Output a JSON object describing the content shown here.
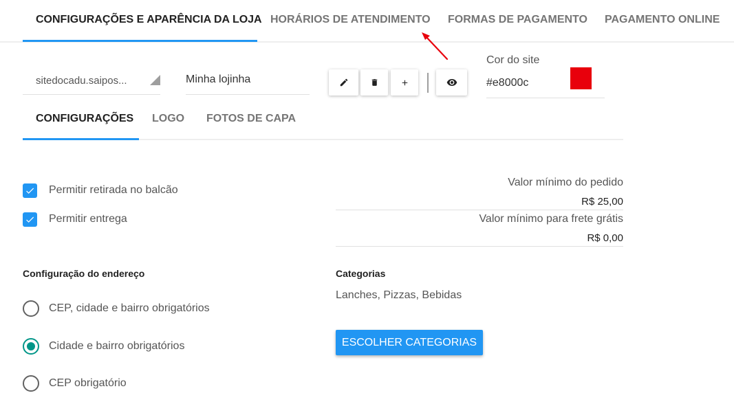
{
  "top_tabs": [
    {
      "label": "CONFIGURAÇÕES E APARÊNCIA DA LOJA",
      "active": true
    },
    {
      "label": "HORÁRIOS DE ATENDIMENTO",
      "active": false
    },
    {
      "label": "FORMAS DE PAGAMENTO",
      "active": false
    },
    {
      "label": "PAGAMENTO ONLINE",
      "active": false
    }
  ],
  "store": {
    "selected_site": "sitedocadu.saipos...",
    "name": "Minha lojinha",
    "buttons": {
      "edit_icon": "pencil-icon",
      "delete_icon": "trash-icon",
      "add_icon": "plus-icon",
      "preview_icon": "eye-icon"
    }
  },
  "site_color": {
    "label": "Cor do site",
    "value": "#e8000c",
    "swatch": "#e8000c"
  },
  "sub_tabs": [
    {
      "label": "CONFIGURAÇÕES",
      "active": true
    },
    {
      "label": "LOGO",
      "active": false
    },
    {
      "label": "FOTOS DE CAPA",
      "active": false
    }
  ],
  "options": [
    {
      "label": "Permitir retirada no balcão",
      "checked": true
    },
    {
      "label": "Permitir entrega",
      "checked": true
    }
  ],
  "min_order": {
    "label": "Valor mínimo do pedido",
    "value": "R$ 25,00"
  },
  "min_free_shipping": {
    "label": "Valor mínimo para frete grátis",
    "value": "R$ 0,00"
  },
  "address": {
    "heading": "Configuração do endereço",
    "options": [
      {
        "label": "CEP, cidade e bairro obrigatórios",
        "checked": false
      },
      {
        "label": "Cidade e bairro obrigatórios",
        "checked": true
      },
      {
        "label": "CEP obrigatório",
        "checked": false
      }
    ]
  },
  "categories": {
    "heading": "Categorias",
    "list": "Lanches, Pizzas, Bebidas",
    "button": "ESCOLHER CATEGORIAS"
  },
  "colors": {
    "accent": "#2196f3",
    "radio_checked": "#009688",
    "annotation_arrow": "#e8000c"
  }
}
